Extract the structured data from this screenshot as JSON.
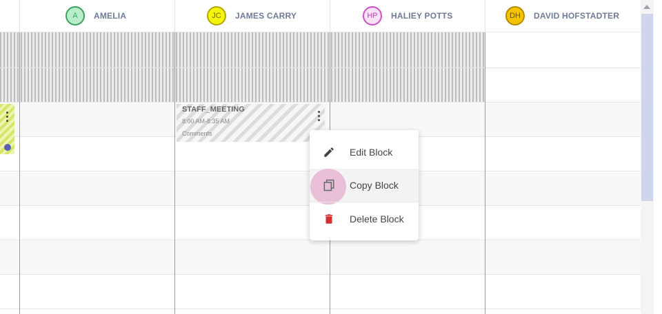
{
  "columns": [
    {
      "initials": "A",
      "name": "AMELIA",
      "avatar_bg": "#b9ecc9",
      "avatar_border": "#3aa35c",
      "avatar_text": "#3aa35c"
    },
    {
      "initials": "JC",
      "name": "JAMES CARRY",
      "avatar_bg": "#f4f40c",
      "avatar_border": "#b3a600",
      "avatar_text": "#6b6a00"
    },
    {
      "initials": "HP",
      "name": "HALIEY POTTS",
      "avatar_bg": "#fbe2f6",
      "avatar_border": "#d04fc9",
      "avatar_text": "#c23bbd"
    },
    {
      "initials": "DH",
      "name": "DAVID HOFSTADTER",
      "avatar_bg": "#f6c300",
      "avatar_border": "#b38b00",
      "avatar_text": "#6b5500"
    }
  ],
  "block": {
    "title": "STAFF_MEETING",
    "time": "8:00 AM-8:35 AM",
    "comments": "Comments"
  },
  "context_menu": {
    "items": [
      {
        "label": "Edit Block",
        "icon": "pencil-icon",
        "color": "#444444"
      },
      {
        "label": "Copy Block",
        "icon": "copy-icon",
        "color": "#444444"
      },
      {
        "label": "Delete Block",
        "icon": "trash-icon",
        "color": "#d32f2f"
      }
    ]
  },
  "colors": {
    "left_block": "#d6e56a",
    "status_dot": "#5b5fb5",
    "scroll_thumb": "#cdd6ec",
    "header_text": "#6f7a99"
  }
}
